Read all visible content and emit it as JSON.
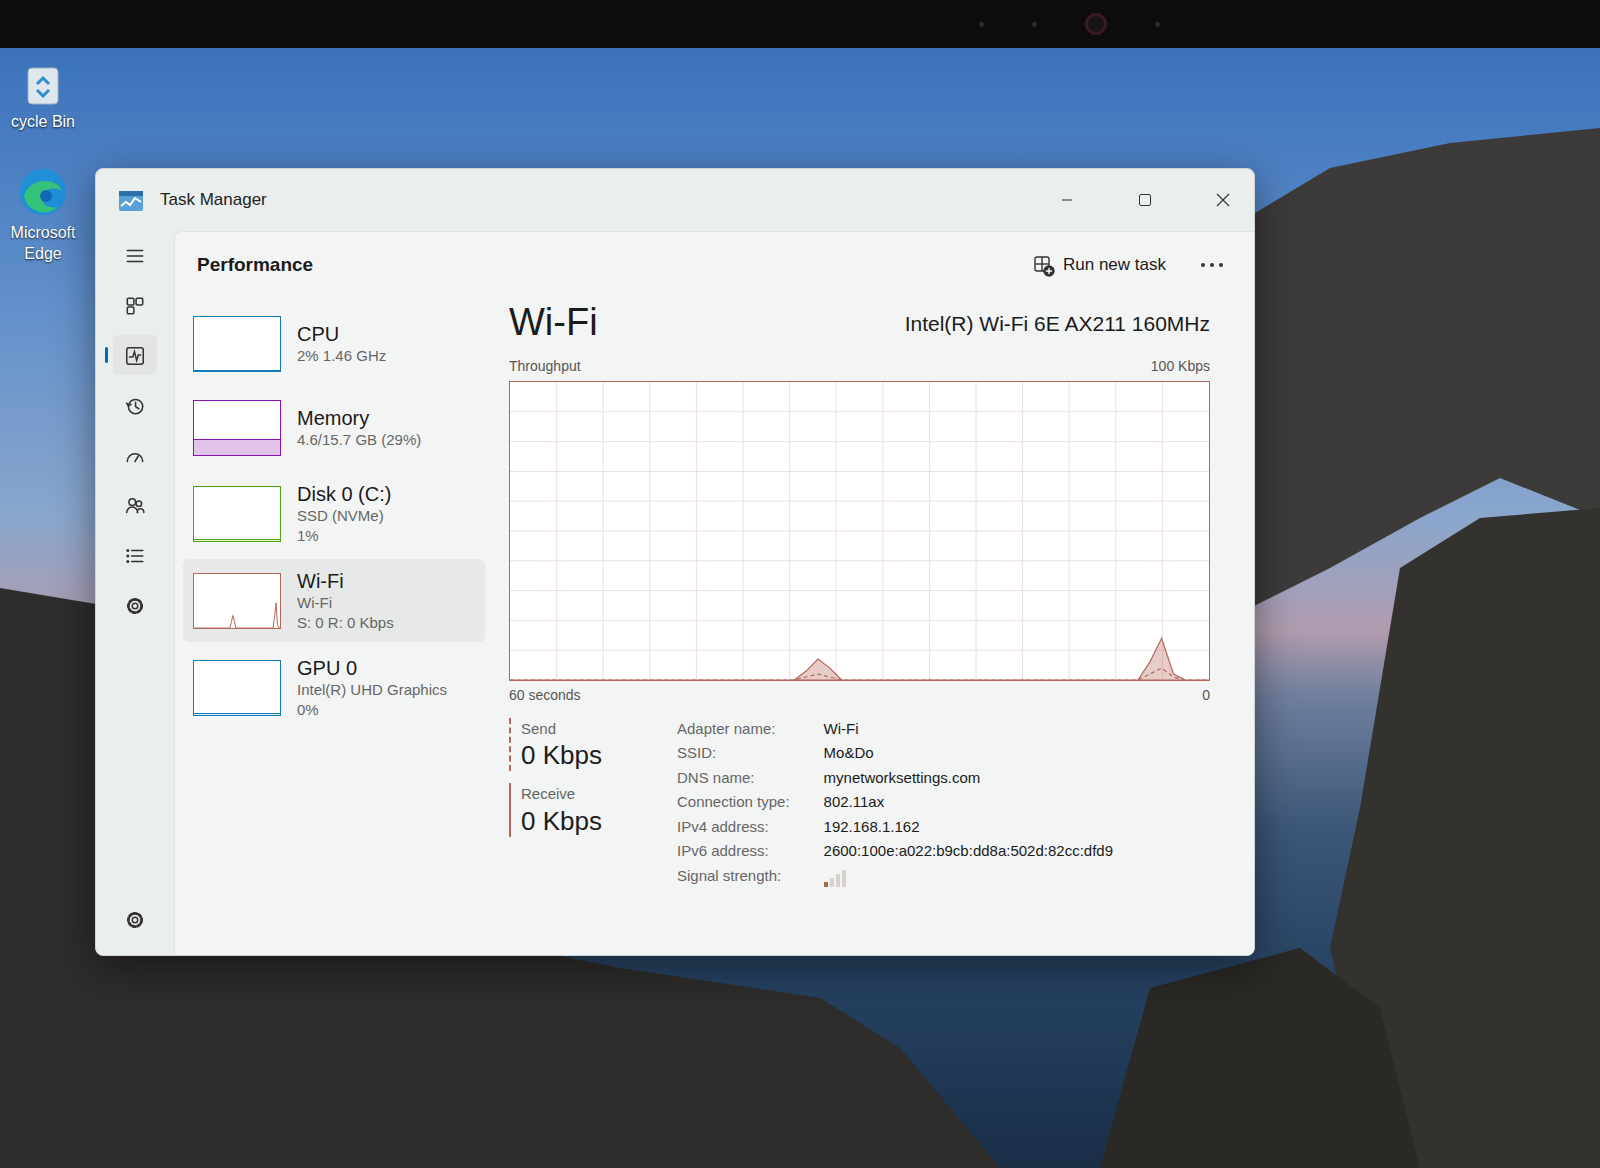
{
  "desktop": {
    "icons": [
      {
        "label": "cycle Bin"
      },
      {
        "label": "Microsoft Edge"
      }
    ]
  },
  "window": {
    "title": "Task Manager"
  },
  "nav": [
    {
      "selected": false
    },
    {
      "selected": false
    },
    {
      "selected": true
    },
    {
      "selected": false
    },
    {
      "selected": false
    },
    {
      "selected": false
    },
    {
      "selected": false
    },
    {
      "selected": false
    },
    {
      "selected": false
    }
  ],
  "header": {
    "title": "Performance",
    "run_task": "Run new task"
  },
  "resources": [
    {
      "name": "CPU",
      "lines": [
        "2% 1.46 GHz"
      ],
      "selected": false,
      "color": "#117dbb",
      "kind": "line",
      "level": 0.02
    },
    {
      "name": "Memory",
      "lines": [
        "4.6/15.7 GB (29%)"
      ],
      "selected": false,
      "color": "#8b12ae",
      "kind": "fill",
      "level": 0.29
    },
    {
      "name": "Disk 0 (C:)",
      "lines": [
        "SSD (NVMe)",
        "1%"
      ],
      "selected": false,
      "color": "#4da60c",
      "kind": "line",
      "level": 0.01
    },
    {
      "name": "Wi-Fi",
      "lines": [
        "Wi-Fi",
        "S: 0 R: 0 Kbps"
      ],
      "selected": true,
      "color": "#b4685a",
      "kind": "net"
    },
    {
      "name": "GPU 0",
      "lines": [
        "Intel(R) UHD Graphics",
        "0%"
      ],
      "selected": false,
      "color": "#117dbb",
      "kind": "line",
      "level": 0
    }
  ],
  "detail": {
    "title": "Wi-Fi",
    "adapter": "Intel(R) Wi-Fi 6E AX211 160MHz",
    "axis_label": "Throughput",
    "axis_max": "100 Kbps",
    "time_label": "60 seconds",
    "time_end": "0",
    "max": 100,
    "receive": [
      0,
      0,
      0,
      0,
      0,
      0,
      0,
      0,
      0,
      0,
      0,
      0,
      0,
      0,
      0,
      0,
      0,
      0,
      0,
      0,
      0,
      0,
      0,
      0,
      0,
      3,
      7,
      4,
      0,
      0,
      0,
      0,
      0,
      0,
      0,
      0,
      0,
      0,
      0,
      0,
      0,
      0,
      0,
      0,
      0,
      0,
      0,
      0,
      0,
      0,
      0,
      0,
      0,
      0,
      6,
      14,
      2,
      0,
      0,
      0
    ],
    "send": [
      0,
      0,
      0,
      0,
      0,
      0,
      0,
      0,
      0,
      0,
      0,
      0,
      0,
      0,
      0,
      0,
      0,
      0,
      0,
      0,
      0,
      0,
      0,
      0,
      0,
      1,
      2,
      1,
      0,
      0,
      0,
      0,
      0,
      0,
      0,
      0,
      0,
      0,
      0,
      0,
      0,
      0,
      0,
      0,
      0,
      0,
      0,
      0,
      0,
      0,
      0,
      0,
      0,
      0,
      2,
      4,
      1,
      0,
      0,
      0
    ]
  },
  "stats": [
    {
      "label": "Send",
      "value": "0 Kbps",
      "kind": "dashed"
    },
    {
      "label": "Receive",
      "value": "0 Kbps",
      "kind": "solid"
    }
  ],
  "properties": [
    {
      "label": "Adapter name:",
      "value": "Wi-Fi",
      "kind": "text"
    },
    {
      "label": "SSID:",
      "value": "Mo&Do",
      "kind": "text"
    },
    {
      "label": "DNS name:",
      "value": "mynetworksettings.com",
      "kind": "text"
    },
    {
      "label": "Connection type:",
      "value": "802.11ax",
      "kind": "text"
    },
    {
      "label": "IPv4 address:",
      "value": "192.168.1.162",
      "kind": "text"
    },
    {
      "label": "IPv6 address:",
      "value": "2600:100e:a022:b9cb:dd8a:502d:82cc:dfd9",
      "kind": "text"
    },
    {
      "label": "Signal strength:",
      "kind": "signal",
      "level": 0.25
    }
  ]
}
